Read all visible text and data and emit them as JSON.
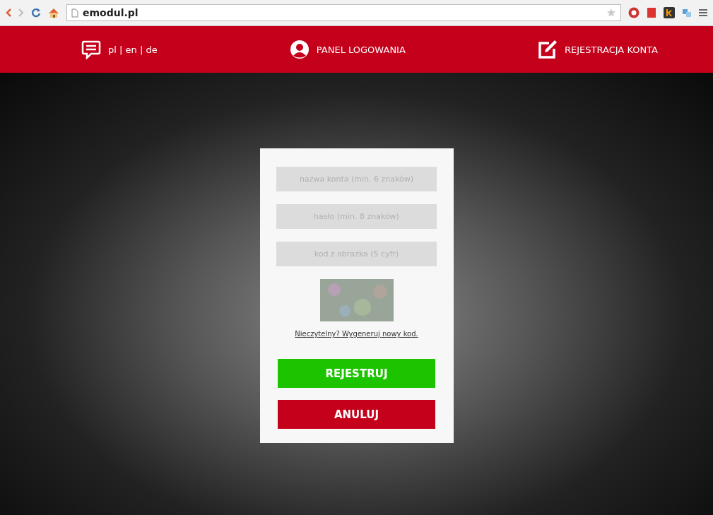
{
  "browser": {
    "url": "emodul.pl"
  },
  "nav": {
    "languages": "pl | en | de",
    "login": "PANEL LOGOWANIA",
    "register": "REJESTRACJA KONTA"
  },
  "form": {
    "fields": [
      {
        "placeholder": "nazwa konta (min. 6 znaków)"
      },
      {
        "placeholder": "hasło (min. 8 znaków)"
      },
      {
        "placeholder": "kod z obrazka (5 cyfr)"
      }
    ],
    "refresh_link": "Nieczytelny? Wygeneruj nowy kod.",
    "buttons": [
      {
        "label": "REJESTRUJ",
        "kind": "primary"
      },
      {
        "label": "ANULUJ",
        "kind": "cancel"
      }
    ]
  }
}
